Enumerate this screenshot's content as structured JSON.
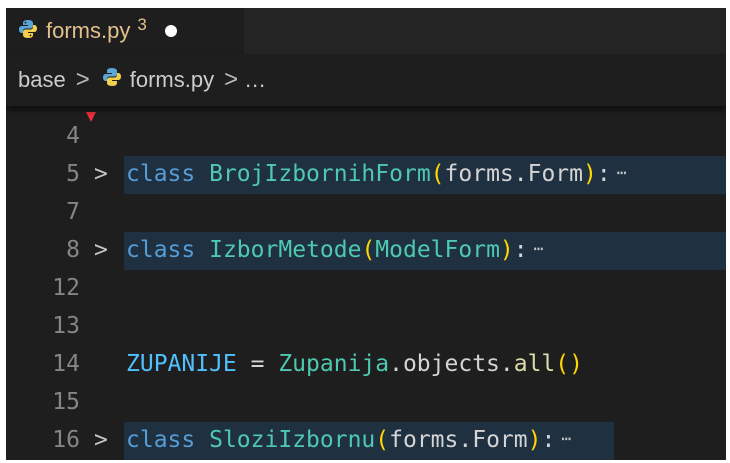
{
  "tab": {
    "title": "forms.py",
    "badge": "3",
    "icon": "python-icon",
    "dirty": true
  },
  "breadcrumb": {
    "folder": "base",
    "file": "forms.py",
    "ellipsis": "…",
    "separator": ">"
  },
  "editor": {
    "lines": [
      {
        "number": "4"
      },
      {
        "number": "5",
        "folded": true,
        "keyword": "class",
        "name": "BrojIzbornihForm",
        "open": "(",
        "base": "forms.Form",
        "close": ")",
        "colon": ":",
        "more": "⋯"
      },
      {
        "number": "7"
      },
      {
        "number": "8",
        "folded": true,
        "keyword": "class",
        "name": "IzborMetode",
        "open": "(",
        "base": "ModelForm",
        "close": ")",
        "colon": ":",
        "more": "⋯"
      },
      {
        "number": "12"
      },
      {
        "number": "13"
      },
      {
        "number": "14",
        "var": "ZUPANIJE",
        "op": " = ",
        "obj": "Zupanija",
        "attr": ".objects.",
        "fn": "all",
        "parens": "()"
      },
      {
        "number": "15"
      },
      {
        "number": "16",
        "folded": true,
        "keyword": "class",
        "name": "SloziIzbornu",
        "open": "(",
        "base": "forms.Form",
        "close": ")",
        "colon": ":",
        "more": "⋯"
      }
    ],
    "fold_glyph": ">"
  },
  "colors": {
    "background": "#1e1e1e",
    "keyword": "#569cd6",
    "class_name": "#4ec9b0",
    "bracket": "#ffd700",
    "variable": "#4fc1ff",
    "function": "#dcdcaa",
    "modified_tab": "#e2c08d",
    "folded_highlight": "#1f3140"
  }
}
